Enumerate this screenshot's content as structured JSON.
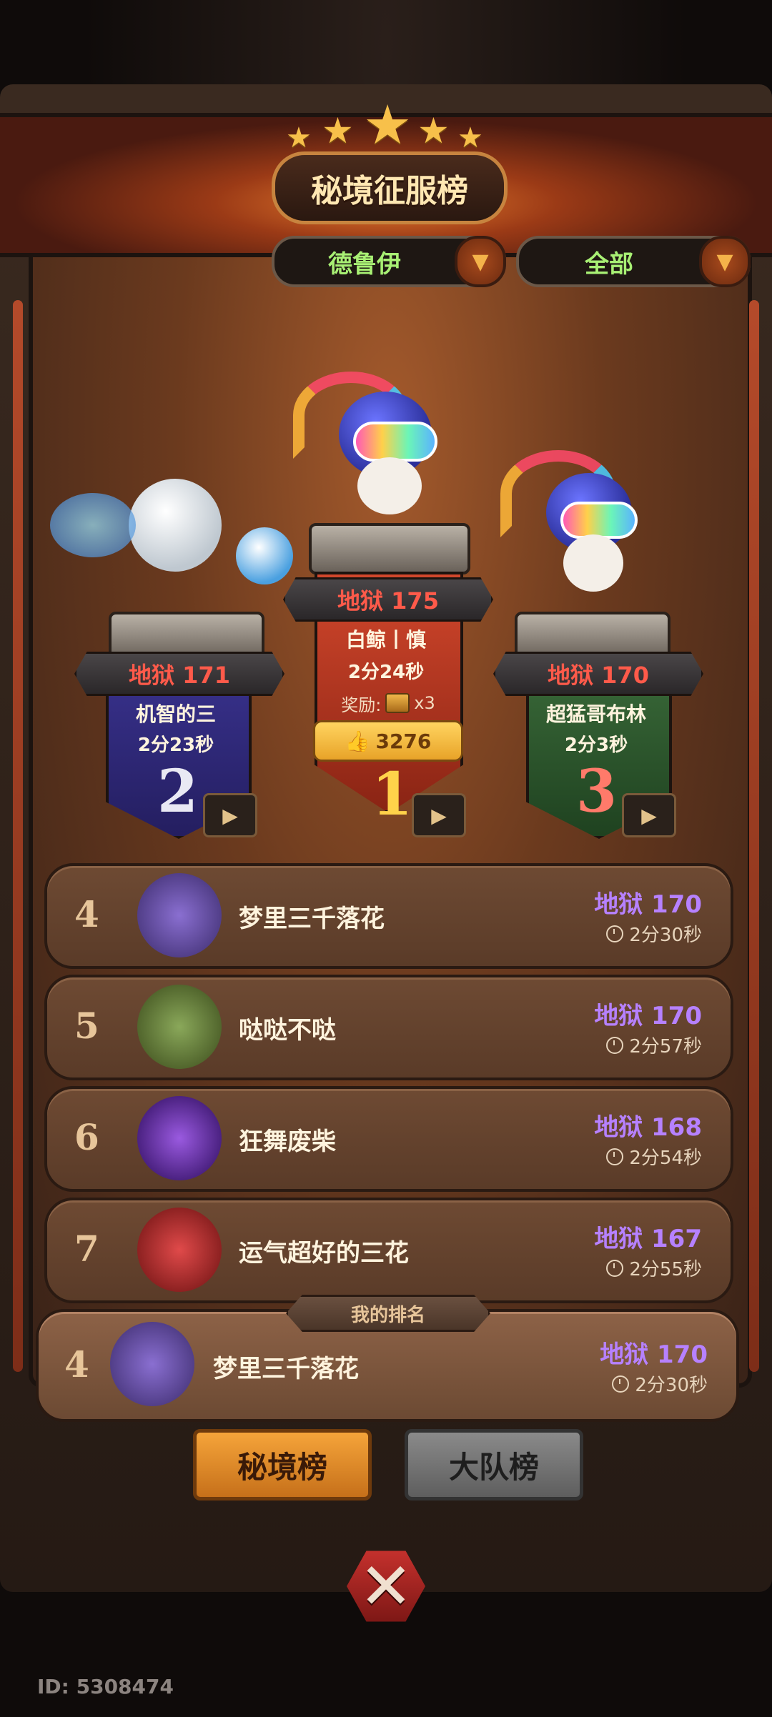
{
  "header": {
    "title": "秘境征服榜",
    "stars": 5
  },
  "filters": {
    "class_select": "德鲁伊",
    "scope_select": "全部"
  },
  "podium": [
    {
      "rank": "2",
      "level": "地狱 171",
      "name": "机智的三",
      "time": "2分23秒"
    },
    {
      "rank": "1",
      "level": "地狱 175",
      "name": "白鲸丨慎",
      "time": "2分24秒",
      "reward_label": "奖励:",
      "reward_qty": "x3",
      "likes": "3276"
    },
    {
      "rank": "3",
      "level": "地狱 170",
      "name": "超猛哥布林",
      "time": "2分3秒"
    }
  ],
  "list": [
    {
      "rank": "4",
      "name": "梦里三千落花",
      "level": "地狱 170",
      "time": "2分30秒",
      "avatar_color": "#8a6fd1"
    },
    {
      "rank": "5",
      "name": "哒哒不哒",
      "level": "地狱 170",
      "time": "2分57秒",
      "avatar_color": "#6b8a3a"
    },
    {
      "rank": "6",
      "name": "狂舞废柴",
      "level": "地狱 168",
      "time": "2分54秒",
      "avatar_color": "#5a2a9a"
    },
    {
      "rank": "7",
      "name": "运气超好的三花",
      "level": "地狱 167",
      "time": "2分55秒",
      "avatar_color": "#c83a3a"
    }
  ],
  "my_rank": {
    "tag": "我的排名",
    "rank": "4",
    "name": "梦里三千落花",
    "level": "地狱 170",
    "time": "2分30秒"
  },
  "tabs": {
    "active": "秘境榜",
    "inactive": "大队榜"
  },
  "footer": {
    "player_id": "ID: 5308474"
  },
  "colors": {
    "level_red": "#ff5a4a",
    "level_purple": "#b681ff",
    "accent_gold": "#f5a43a",
    "filter_green": "#a8f074"
  },
  "icons": {
    "video": "video-camera-icon",
    "like": "thumbs-up-icon",
    "reward": "treasure-chest-icon",
    "close": "crossed-swords-close-icon",
    "dropdown": "triangle-down-icon",
    "clock": "clock-icon"
  }
}
